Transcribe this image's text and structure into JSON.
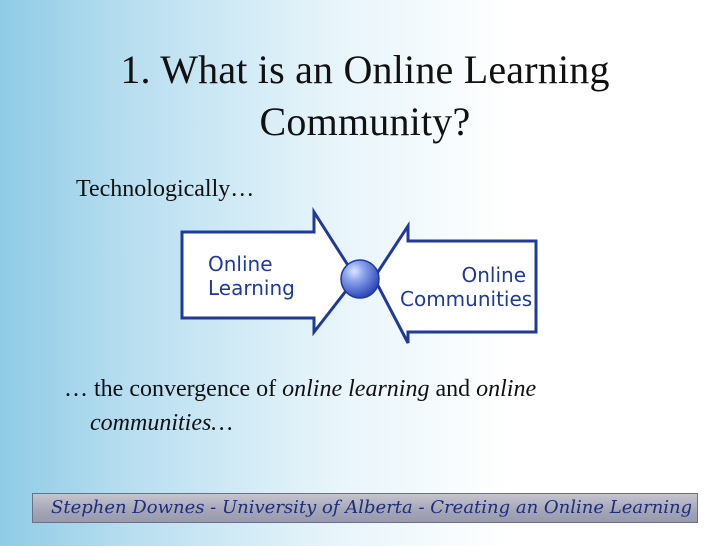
{
  "slide": {
    "title": "1. What is an Online Learning Community?",
    "subtitle": "Technologically…",
    "diagram": {
      "left_label_line1": "Online",
      "left_label_line2": "Learning",
      "right_label_line1": "Online",
      "right_label_line2": "Communities",
      "colors": {
        "arrow_fill": "#ffffff",
        "arrow_stroke": "#1f3a9a",
        "node_fill": "#5c73d9",
        "node_highlight": "#d9e3ff"
      }
    },
    "body": {
      "prefix": "… the convergence of",
      "online_learning": "online learning",
      "and": "and",
      "online": "online",
      "communities": "communities…"
    },
    "footer": {
      "text": "Stephen Downes  -  University of Alberta  -  Creating an Online Learning Community"
    }
  }
}
